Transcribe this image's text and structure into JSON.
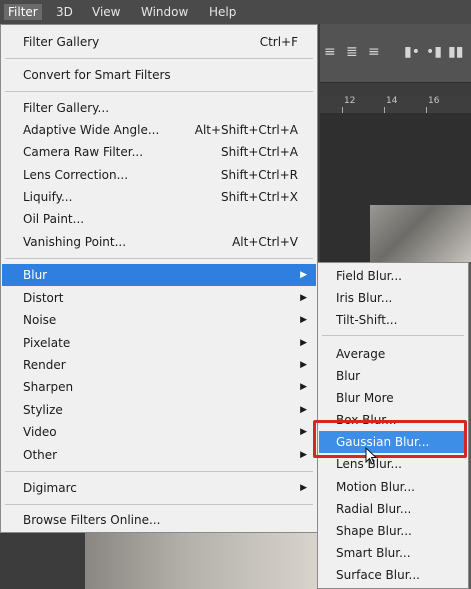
{
  "menubar": {
    "items": [
      "Filter",
      "3D",
      "View",
      "Window",
      "Help"
    ]
  },
  "filter_menu": {
    "items": [
      {
        "label": "Filter Gallery",
        "shortcut": "Ctrl+F"
      },
      {
        "label": "Convert for Smart Filters",
        "shortcut": ""
      },
      {
        "label": "Filter Gallery...",
        "shortcut": ""
      },
      {
        "label": "Adaptive Wide Angle...",
        "shortcut": "Alt+Shift+Ctrl+A"
      },
      {
        "label": "Camera Raw Filter...",
        "shortcut": "Shift+Ctrl+A"
      },
      {
        "label": "Lens Correction...",
        "shortcut": "Shift+Ctrl+R"
      },
      {
        "label": "Liquify...",
        "shortcut": "Shift+Ctrl+X"
      },
      {
        "label": "Oil Paint...",
        "shortcut": ""
      },
      {
        "label": "Vanishing Point...",
        "shortcut": "Alt+Ctrl+V"
      },
      {
        "label": "Blur",
        "shortcut": ""
      },
      {
        "label": "Distort",
        "shortcut": ""
      },
      {
        "label": "Noise",
        "shortcut": ""
      },
      {
        "label": "Pixelate",
        "shortcut": ""
      },
      {
        "label": "Render",
        "shortcut": ""
      },
      {
        "label": "Sharpen",
        "shortcut": ""
      },
      {
        "label": "Stylize",
        "shortcut": ""
      },
      {
        "label": "Video",
        "shortcut": ""
      },
      {
        "label": "Other",
        "shortcut": ""
      },
      {
        "label": "Digimarc",
        "shortcut": ""
      },
      {
        "label": "Browse Filters Online...",
        "shortcut": ""
      }
    ]
  },
  "blur_submenu": {
    "items": [
      "Field Blur...",
      "Iris Blur...",
      "Tilt-Shift...",
      "Average",
      "Blur",
      "Blur More",
      "Box Blur...",
      "Gaussian Blur...",
      "Lens Blur...",
      "Motion Blur...",
      "Radial Blur...",
      "Shape Blur...",
      "Smart Blur...",
      "Surface Blur..."
    ]
  },
  "ruler": {
    "ticks": [
      "12",
      "14",
      "16"
    ]
  },
  "icons": {
    "submenu_arrow": "triangle-right",
    "cursor": "arrow-pointer"
  },
  "colors": {
    "selection": "#2f7fe0",
    "highlight_box": "#d7261f"
  }
}
